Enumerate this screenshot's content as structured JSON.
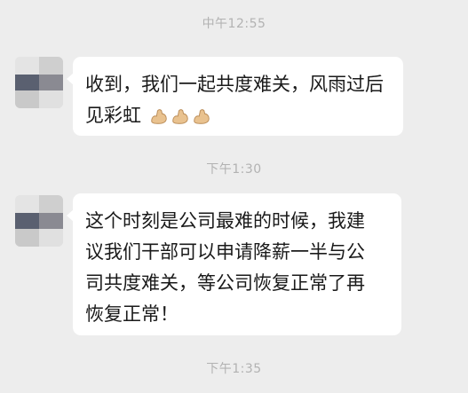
{
  "chat": {
    "timestamps": [
      "中午12:55",
      "下午1:30",
      "下午1:35"
    ],
    "messages": [
      {
        "lines": [
          "收到，我们一起共度难关，风雨过后",
          "见彩虹"
        ],
        "emoji": [
          "flexed-biceps-icon",
          "flexed-biceps-icon",
          "flexed-biceps-icon"
        ]
      },
      {
        "lines": [
          "这个时刻是公司最难的时候，我建",
          "议我们干部可以申请降薪一半与公",
          "司共度难关，等公司恢复正常了再",
          "恢复正常！"
        ]
      }
    ]
  },
  "colors": {
    "background": "#ededed",
    "bubble": "#ffffff",
    "timestamp": "#b2b2b2",
    "text": "#1a1a1a"
  }
}
